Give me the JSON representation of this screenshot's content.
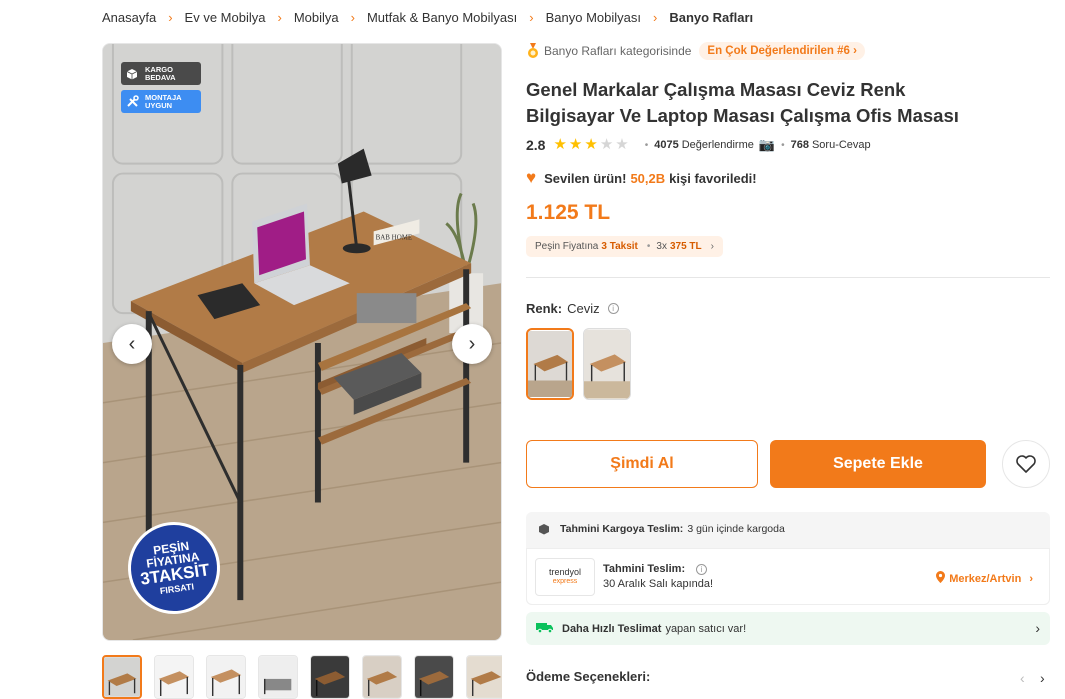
{
  "breadcrumb": [
    "Anasayfa",
    "Ev ve Mobilya",
    "Mobilya",
    "Mutfak & Banyo Mobilyası",
    "Banyo Mobilyası",
    "Banyo Rafları"
  ],
  "gallery": {
    "badges": {
      "kargo": [
        "KARGO",
        "BEDAVA"
      ],
      "montaj": [
        "MONTAJA",
        "UYGUN"
      ]
    },
    "promo": [
      "PEŞİN",
      "FİYATINA",
      "3TAKSİT",
      "FIRSATI"
    ],
    "brand_box_text": "BAB HOME",
    "prev_icon": "chevron-left-icon",
    "next_icon": "chevron-right-icon",
    "thumb_count": 8
  },
  "category_rank": {
    "category_text": "Banyo Rafları kategorisinde",
    "rank_text": "En Çok Değerlendirilen #6"
  },
  "product": {
    "brand": "Genel Markalar",
    "name": "Çalışma Masası Ceviz Renk Bilgisayar Ve Laptop Masası Çalışma Ofis Masası",
    "rating": "2.8",
    "stars_filled": 3,
    "stars_total": 5,
    "review_count": "4075",
    "review_label": "Değerlendirme",
    "qa_count": "768",
    "qa_label": "Soru-Cevap",
    "favorite_prefix": "Sevilen ürün!",
    "favorite_count": "50,2B",
    "favorite_suffix": "kişi favoriledi!",
    "price": "1.125 TL"
  },
  "installment": {
    "prefix": "Peşin Fiyatına",
    "taksit": "3 Taksit",
    "times": "3x",
    "amount": "375 TL"
  },
  "color": {
    "label": "Renk:",
    "value": "Ceviz"
  },
  "actions": {
    "buy_now": "Şimdi Al",
    "add_to_cart": "Sepete Ekle"
  },
  "delivery": {
    "cargo_label": "Tahmini Kargoya Teslim:",
    "cargo_value": "3 gün içinde kargoda",
    "logo_main": "trendyol",
    "logo_sub": "express",
    "est_label": "Tahmini Teslim:",
    "est_value": "30 Aralık Salı kapında!",
    "location": "Merkez/Artvin"
  },
  "fast": {
    "bold": "Daha Hızlı Teslimat",
    "rest": "yapan satıcı var!"
  },
  "payment": {
    "title": "Ödeme Seçenekleri:"
  },
  "colors": {
    "accent": "#f27a1a",
    "star": "#ffc000",
    "fast_green": "#0bc15c"
  }
}
